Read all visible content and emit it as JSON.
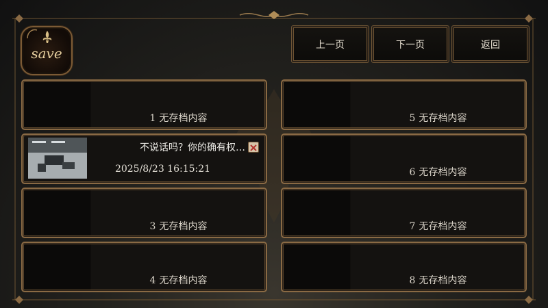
{
  "logo": {
    "text": "save"
  },
  "nav": {
    "prev_label": "上一页",
    "next_label": "下一页",
    "back_label": "返回"
  },
  "slots": [
    {
      "number": "1",
      "label": "无存档内容"
    },
    {
      "number": "",
      "preview": "不说话吗？你的确有权…",
      "timestamp": "2025/8/23 16:15:21"
    },
    {
      "number": "3",
      "label": "无存档内容"
    },
    {
      "number": "4",
      "label": "无存档内容"
    },
    {
      "number": "5",
      "label": "无存档内容"
    },
    {
      "number": "6",
      "label": "无存档内容"
    },
    {
      "number": "7",
      "label": "无存档内容"
    },
    {
      "number": "8",
      "label": "无存档内容"
    }
  ],
  "colors": {
    "gold_border": "#8a6a44",
    "text": "#d9d3c8",
    "delete_mark": "#b2332d"
  },
  "icons": [
    "fleur-de-lis-icon",
    "delete-icon",
    "corner-ornament-icon"
  ]
}
